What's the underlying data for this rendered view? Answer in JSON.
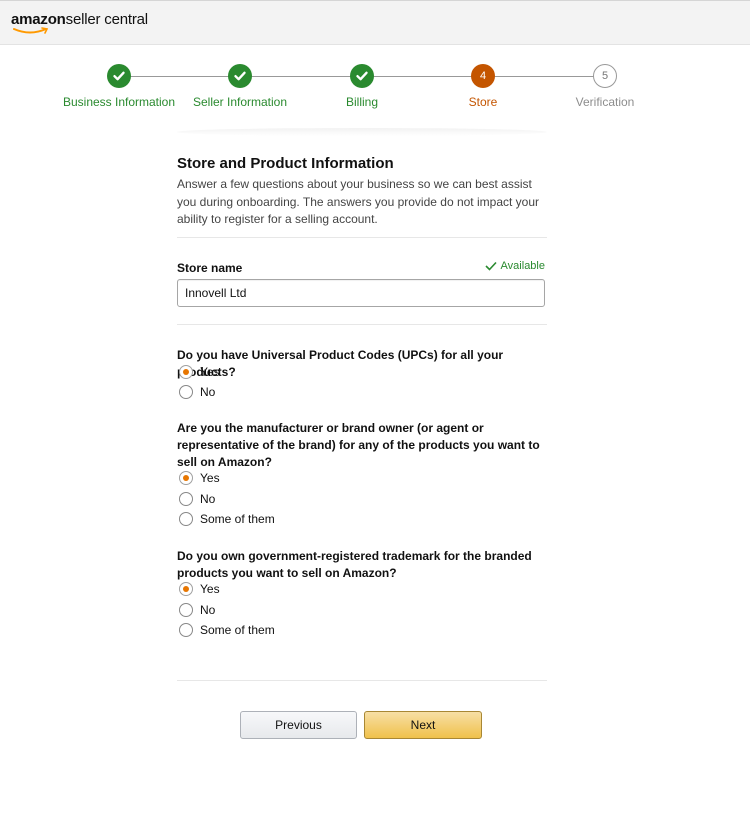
{
  "header": {
    "logo_brand": "amazon",
    "logo_product": "seller central"
  },
  "stepper": {
    "steps": [
      {
        "label": "Business Information",
        "state": "done",
        "number": ""
      },
      {
        "label": "Seller Information",
        "state": "done",
        "number": ""
      },
      {
        "label": "Billing",
        "state": "done",
        "number": ""
      },
      {
        "label": "Store",
        "state": "active",
        "number": "4"
      },
      {
        "label": "Verification",
        "state": "pending",
        "number": "5"
      }
    ]
  },
  "form": {
    "title": "Store and Product Information",
    "description": "Answer a few questions about your business so we can best assist you during onboarding. The answers you provide do not impact your ability to register for a selling account.",
    "store_name_label": "Store name",
    "availability_text": "Available",
    "store_name_value": "Innovell Ltd",
    "questions": [
      {
        "text": "Do you have Universal Product Codes (UPCs) for all your products?",
        "options": [
          "Yes",
          "No"
        ],
        "selected": "Yes"
      },
      {
        "text": "Are you the manufacturer or brand owner (or agent or representative of the brand) for any of the products you want to sell on Amazon?",
        "options": [
          "Yes",
          "No",
          "Some of them"
        ],
        "selected": "Yes"
      },
      {
        "text": "Do you own government-registered trademark for the branded products you want to sell on Amazon?",
        "options": [
          "Yes",
          "No",
          "Some of them"
        ],
        "selected": "Yes"
      }
    ]
  },
  "buttons": {
    "previous": "Previous",
    "next": "Next"
  },
  "colors": {
    "done": "#2a8a2f",
    "active": "#c45500",
    "radio_selected": "#e77600",
    "next_button": "#f0c14b"
  }
}
